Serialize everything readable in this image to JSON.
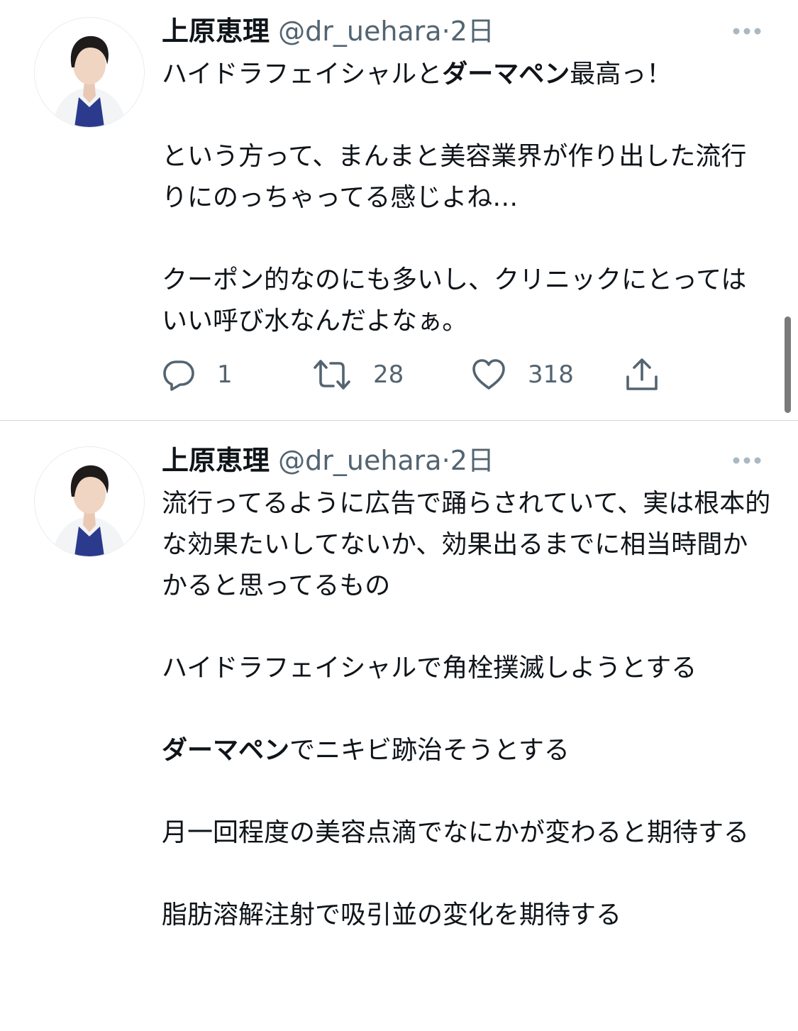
{
  "tweets": [
    {
      "author_name": "上原恵理",
      "handle": "@dr_uehara",
      "separator": "·",
      "time": "2日",
      "paragraphs": [
        [
          {
            "text": "ハイドラフェイシャルと",
            "bold": false
          },
          {
            "text": "ダーマペン",
            "bold": true
          },
          {
            "text": "最高っ！",
            "bold": false
          }
        ],
        [
          {
            "text": "という方って、まんまと美容業界が作り出した流行りにのっちゃってる感じよね…",
            "bold": false
          }
        ],
        [
          {
            "text": "クーポン的なのにも多いし、クリニックにとってはいい呼び水なんだよなぁ。",
            "bold": false
          }
        ]
      ],
      "actions": {
        "reply_count": "1",
        "retweet_count": "28",
        "like_count": "318"
      }
    },
    {
      "author_name": "上原恵理",
      "handle": "@dr_uehara",
      "separator": "·",
      "time": "2日",
      "paragraphs": [
        [
          {
            "text": "流行ってるように広告で踊らされていて、実は根本的な効果たいしてないか、効果出るまでに相当時間かかると思ってるもの",
            "bold": false
          }
        ],
        [
          {
            "text": "ハイドラフェイシャルで角栓撲滅しようとする",
            "bold": false
          }
        ],
        [
          {
            "text": "ダーマペン",
            "bold": true
          },
          {
            "text": "でニキビ跡治そうとする",
            "bold": false
          }
        ],
        [
          {
            "text": "月一回程度の美容点滴でなにかが変わると期待する",
            "bold": false
          }
        ],
        [
          {
            "text": "脂肪溶解注射で吸引並の変化を期待する",
            "bold": false
          }
        ]
      ]
    }
  ],
  "icons": {
    "avatar": "profile-photo",
    "more": "more-horizontal-icon",
    "reply": "reply-icon",
    "retweet": "retweet-icon",
    "like": "heart-icon",
    "share": "share-icon"
  },
  "colors": {
    "text": "#0f1419",
    "secondary": "#536471",
    "divider": "#cfd9de",
    "scrollbar": "#7a7a7a"
  }
}
